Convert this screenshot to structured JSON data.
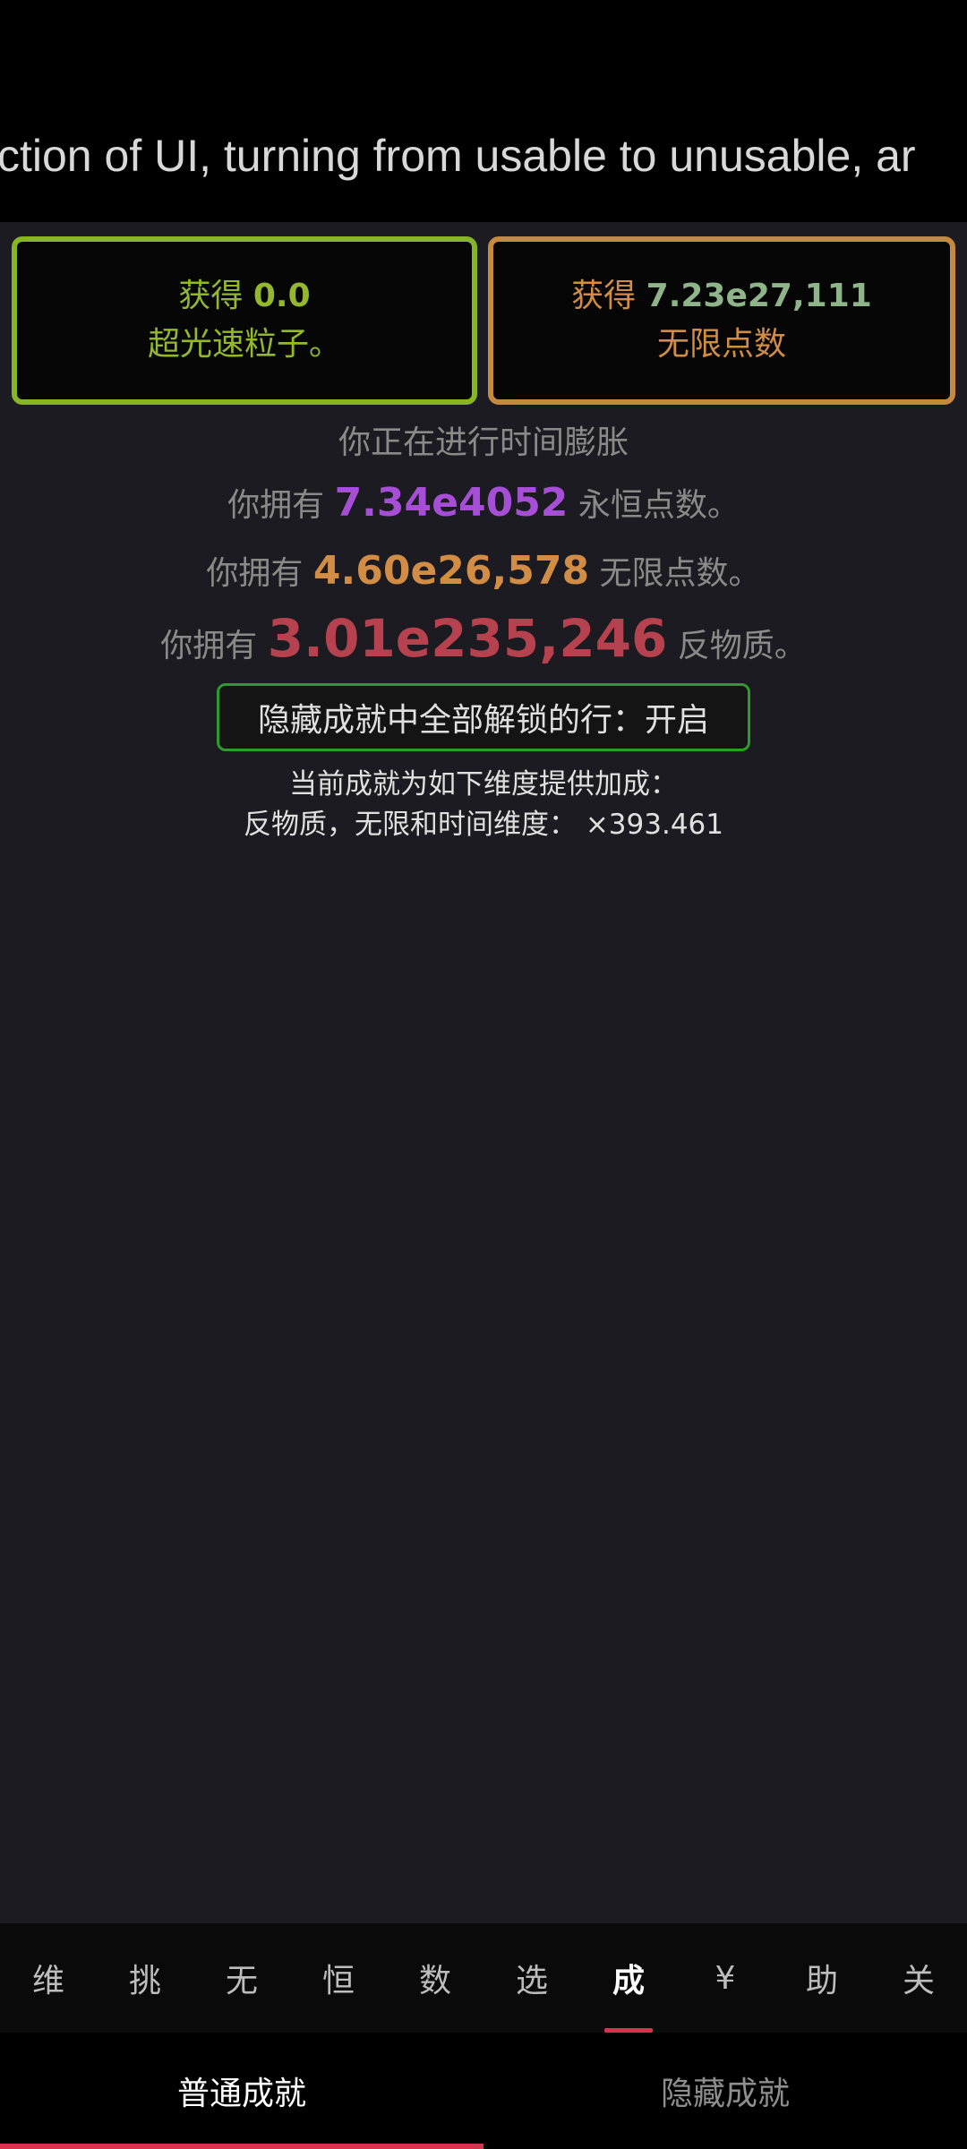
{
  "ticker": {
    "text": "ction of UI, turning from usable to unusable, ar"
  },
  "rewards": {
    "tachyon": {
      "prefix": "获得",
      "amount": "0.0",
      "label": "超光速粒子。"
    },
    "infinity": {
      "prefix": "获得",
      "amount": "7.23e27,111",
      "label": "无限点数"
    }
  },
  "status": {
    "dilation": "你正在进行时间膨胀",
    "eternity": {
      "prefix": "你拥有",
      "value": "7.34e4052",
      "suffix": "永恒点数。"
    },
    "infinity_points": {
      "prefix": "你拥有",
      "value": "4.60e26,578",
      "suffix": "无限点数。"
    },
    "antimatter": {
      "prefix": "你拥有",
      "value": "3.01e235,246",
      "suffix": "反物质。"
    }
  },
  "toggle": {
    "label": "隐藏成就中全部解锁的行：开启"
  },
  "bonus": {
    "line1": "当前成就为如下维度提供加成：",
    "line2": "反物质，无限和时间维度： ×393.461"
  },
  "nav": {
    "items": [
      {
        "label": "维"
      },
      {
        "label": "挑"
      },
      {
        "label": "无"
      },
      {
        "label": "恒"
      },
      {
        "label": "数"
      },
      {
        "label": "选"
      },
      {
        "label": "成"
      },
      {
        "label": "¥"
      },
      {
        "label": "助"
      },
      {
        "label": "关"
      }
    ],
    "active_index": 6
  },
  "subtabs": {
    "items": [
      {
        "label": "普通成就"
      },
      {
        "label": "隐藏成就"
      }
    ],
    "active_index": 0
  },
  "colors": {
    "accent": "#d8324f",
    "tachyon": "#93b830",
    "infinity": "#d18d45",
    "eternity": "#a64ed6",
    "antimatter": "#b5424e",
    "toggle_border": "#2f9b2f"
  }
}
